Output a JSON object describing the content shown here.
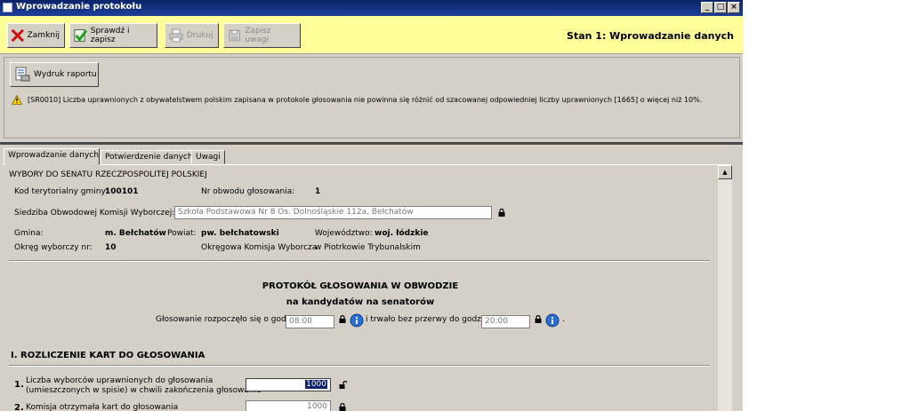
{
  "window": {
    "title": "Wprowadzanie protokołu"
  },
  "toolbar": {
    "close_label": "Zamknij",
    "check_save_label": "Sprawdź i zapisz",
    "print_label": "Drukuj",
    "save_notes_label": "Zapisz uwagi",
    "stage": "Stan 1: Wprowadzanie danych"
  },
  "report": {
    "button_label": "Wydruk raportu",
    "warning": "[SR0010] Liczba uprawnionych z obywatelstwem polskim zapisana w protokole głosowania nie powinna się różnić od szacowanej odpowiedniej liczby uprawnionych [1665] o więcej niż 10%."
  },
  "tabs": [
    "Wprowadzanie danych",
    "Potwierdzenie danych",
    "Uwagi"
  ],
  "form": {
    "election_title": "WYBORY DO SENATU RZECZPOSPOLITEJ POLSKIEJ",
    "territorial_code_label": "Kod terytorialny gminy:",
    "territorial_code": "100101",
    "district_no_label": "Nr obwodu głosowania:",
    "district_no": "1",
    "seat_label": "Siedziba Obwodowej Komisji Wyborczej:",
    "seat_value": "Szkoła Podstawowa Nr 8 Os. Dolnośląskie 112a, Bełchatów",
    "gmina_label": "Gmina:",
    "gmina": "m. Bełchatów",
    "powiat_label": "Powiat:",
    "powiat": "pw. bełchatowski",
    "woj_label": "Województwo:",
    "woj": "woj. łódzkie",
    "okreg_label": "Okręg wyborczy nr:",
    "okreg": "10",
    "okw_label": "Okręgowa Komisja Wyborcza",
    "okw": "w Piotrkowie Trybunalskim",
    "protocol_title_1": "PROTOKÓŁ GŁOSOWANIA W OBWODZIE",
    "protocol_title_2": "na kandydatów na senatorów",
    "start_label": "Głosowanie rozpoczęło się o godz.",
    "start_time": "08:00",
    "until_label": "i trwało bez przerwy do godz.",
    "end_time": "20:00",
    "dot": ".",
    "section1": "I. ROZLICZENIE KART DO GŁOSOWANIA",
    "row1_no": "1.",
    "row1_label_a": "Liczba wyborców uprawnionych do głosowania",
    "row1_label_b": "(umieszczonych w spisie) w chwili zakończenia głosowania",
    "row1_value": "1000",
    "row2_no": "2.",
    "row2_label": "Komisja otrzymała kart do głosowania",
    "row2_value": "1000"
  }
}
